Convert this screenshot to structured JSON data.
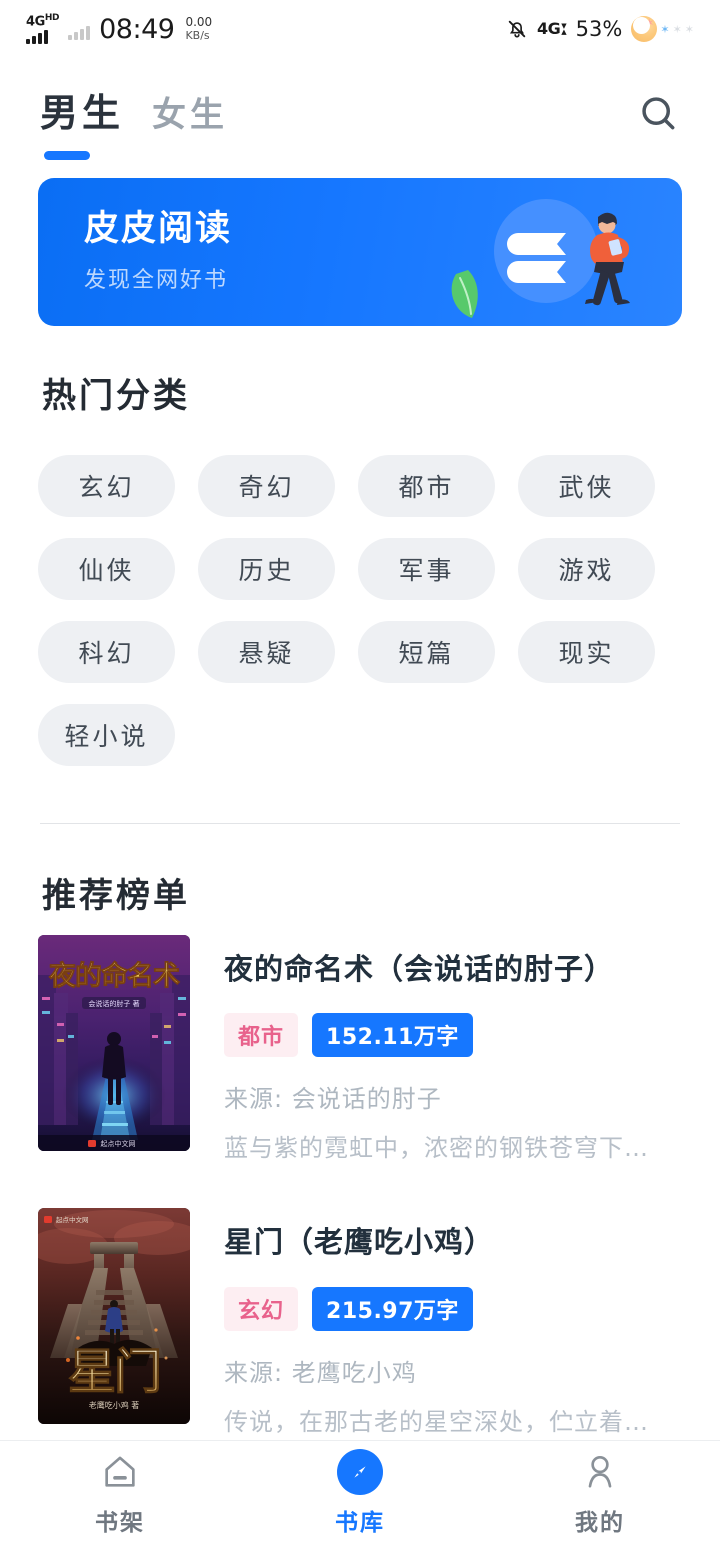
{
  "status_bar": {
    "network_label": "4G",
    "network_sup": "HD",
    "time": "08:49",
    "speed_value": "0.00",
    "speed_unit": "KB/s",
    "mute_icon": "bell-off-icon",
    "secondary_network": "4G",
    "battery_percent": "53%",
    "moon_icon": "moon-star-icon"
  },
  "topnav": {
    "tabs": [
      {
        "label": "男生",
        "active": true
      },
      {
        "label": "女生",
        "active": false
      }
    ],
    "search_icon": "search-icon",
    "accent_color": "#1677ff"
  },
  "banner": {
    "title": "皮皮阅读",
    "subtitle": "发现全网好书",
    "bg_color": "#1677ff",
    "art_icon": "reading-person-illustration"
  },
  "hot_categories": {
    "title": "热门分类",
    "items": [
      "玄幻",
      "奇幻",
      "都市",
      "武侠",
      "仙侠",
      "历史",
      "军事",
      "游戏",
      "科幻",
      "悬疑",
      "短篇",
      "现实",
      "轻小说"
    ],
    "chip_bg": "#eef0f3",
    "chip_text": "#414a54"
  },
  "recommend": {
    "title": "推荐榜单",
    "books": [
      {
        "title": "夜的命名术（会说话的肘子）",
        "genre": "都市",
        "words": "152.11万字",
        "source": "来源: 会说话的肘子",
        "desc": "蓝与紫的霓虹中，浓密的钢铁苍穹下…",
        "cover_title": "夜的命名术",
        "cover_watermark": "起点中文网",
        "cover_name": "book-cover-night-naming"
      },
      {
        "title": "星门（老鹰吃小鸡）",
        "genre": "玄幻",
        "words": "215.97万字",
        "source": "来源: 老鹰吃小鸡",
        "desc": "传说，在那古老的星空深处，伫立着…",
        "cover_title": "星门",
        "cover_watermark": "老鹰吃小鸡 著",
        "cover_name": "book-cover-star-gate"
      }
    ],
    "genre_bg": "#fdeef2",
    "genre_color": "#e8628c",
    "words_bg": "#1677ff"
  },
  "bottom_nav": {
    "items": [
      {
        "label": "书架",
        "icon": "home-bookshelf-icon",
        "active": false
      },
      {
        "label": "书库",
        "icon": "compass-library-icon",
        "active": true
      },
      {
        "label": "我的",
        "icon": "person-profile-icon",
        "active": false
      }
    ],
    "active_color": "#1677ff",
    "inactive_color": "#6f7780"
  }
}
